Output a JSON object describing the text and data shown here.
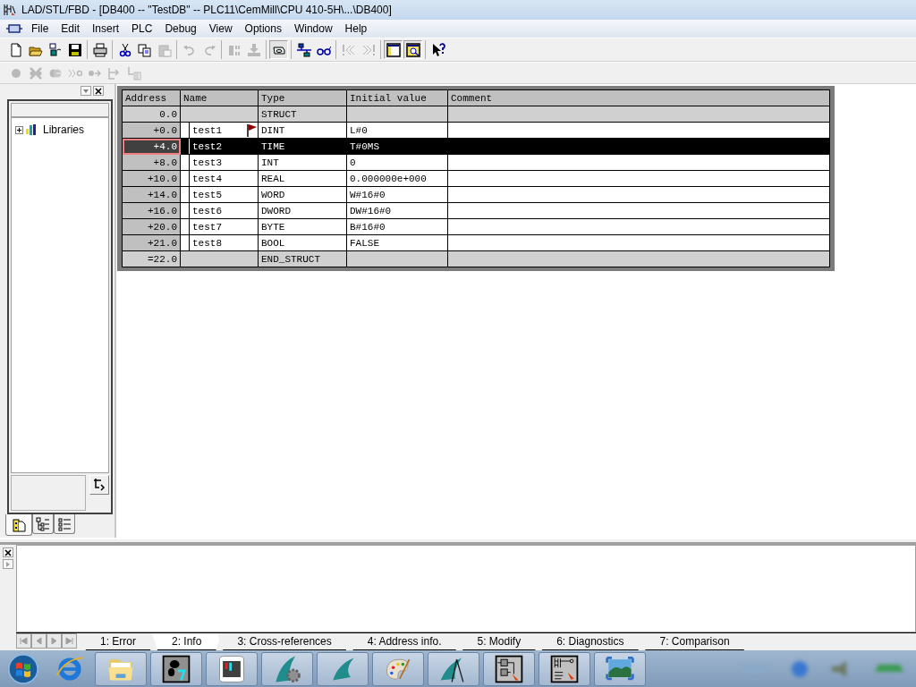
{
  "window": {
    "title": "LAD/STL/FBD  - [DB400 -- \"TestDB\" -- PLC11\\CemMill\\CPU 410-5H\\...\\DB400]"
  },
  "menu": [
    "File",
    "Edit",
    "Insert",
    "PLC",
    "Debug",
    "View",
    "Options",
    "Window",
    "Help"
  ],
  "toolbar": [
    {
      "buttons": [
        {
          "kind": "new",
          "disabled": false,
          "pressed": false
        },
        {
          "kind": "open",
          "disabled": false,
          "pressed": false
        },
        {
          "kind": "station",
          "disabled": false,
          "pressed": false
        },
        {
          "kind": "save",
          "disabled": false,
          "pressed": false
        }
      ]
    },
    {
      "buttons": [
        {
          "kind": "print",
          "disabled": false,
          "pressed": false
        }
      ]
    },
    {
      "buttons": [
        {
          "kind": "cut",
          "disabled": false,
          "pressed": false
        },
        {
          "kind": "copy",
          "disabled": false,
          "pressed": false
        },
        {
          "kind": "paste",
          "disabled": true,
          "pressed": false
        }
      ]
    },
    {
      "buttons": [
        {
          "kind": "undo",
          "disabled": true,
          "pressed": false
        },
        {
          "kind": "redo",
          "disabled": true,
          "pressed": false
        }
      ]
    },
    {
      "buttons": [
        {
          "kind": "block",
          "disabled": true,
          "pressed": false
        },
        {
          "kind": "download",
          "disabled": true,
          "pressed": false
        }
      ]
    },
    {
      "buttons": [
        {
          "kind": "overview",
          "disabled": false,
          "pressed": true
        }
      ]
    },
    {
      "buttons": [
        {
          "kind": "network",
          "disabled": false,
          "pressed": false
        },
        {
          "kind": "glasses",
          "disabled": false,
          "pressed": false
        }
      ]
    },
    {
      "buttons": [
        {
          "kind": "prev-error",
          "disabled": true,
          "pressed": false
        },
        {
          "kind": "next-error",
          "disabled": true,
          "pressed": false
        }
      ]
    },
    {
      "buttons": [
        {
          "kind": "panel",
          "disabled": false,
          "pressed": true
        },
        {
          "kind": "zoom",
          "disabled": false,
          "pressed": true
        }
      ]
    },
    {
      "buttons": [
        {
          "kind": "help",
          "disabled": false,
          "pressed": false
        }
      ]
    }
  ],
  "debug_toolbar": [
    {
      "buttons": [
        {
          "kind": "dot",
          "disabled": true,
          "pressed": false
        },
        {
          "kind": "dot-cross",
          "disabled": true,
          "pressed": false
        },
        {
          "kind": "dots-arrow",
          "disabled": true,
          "pressed": false
        },
        {
          "kind": "run-to",
          "disabled": true,
          "pressed": false
        },
        {
          "kind": "step",
          "disabled": true,
          "pressed": false
        },
        {
          "kind": "step-out",
          "disabled": true,
          "pressed": false
        },
        {
          "kind": "call",
          "disabled": true,
          "pressed": false
        }
      ]
    }
  ],
  "libraries_panel": {
    "tree": [
      {
        "label": "Libraries",
        "expanded": false
      }
    ],
    "tabs": [
      {
        "kind": "libraries",
        "selected": true
      },
      {
        "kind": "tree",
        "selected": false
      },
      {
        "kind": "list",
        "selected": false
      }
    ]
  },
  "table": {
    "columns": [
      "Address",
      "Name",
      "Type",
      "Initial value",
      "Comment"
    ],
    "rows": [
      {
        "kind": "struct",
        "address": "0.0",
        "type": "STRUCT",
        "selected": false
      },
      {
        "kind": "variable",
        "address": "+0.0",
        "name": "test1",
        "type": "DINT",
        "initial_value": "L#0",
        "flagged": true,
        "selected": false
      },
      {
        "kind": "variable",
        "address": "+4.0",
        "name": "test2",
        "type": "TIME",
        "initial_value": "T#0MS",
        "flagged": false,
        "selected": true
      },
      {
        "kind": "variable",
        "address": "+8.0",
        "name": "test3",
        "type": "INT",
        "initial_value": "0",
        "flagged": false,
        "selected": false
      },
      {
        "kind": "variable",
        "address": "+10.0",
        "name": "test4",
        "type": "REAL",
        "initial_value": "0.000000e+000",
        "flagged": false,
        "selected": false
      },
      {
        "kind": "variable",
        "address": "+14.0",
        "name": "test5",
        "type": "WORD",
        "initial_value": "W#16#0",
        "flagged": false,
        "selected": false
      },
      {
        "kind": "variable",
        "address": "+16.0",
        "name": "test6",
        "type": "DWORD",
        "initial_value": "DW#16#0",
        "flagged": false,
        "selected": false
      },
      {
        "kind": "variable",
        "address": "+20.0",
        "name": "test7",
        "type": "BYTE",
        "initial_value": "B#16#0",
        "flagged": false,
        "selected": false
      },
      {
        "kind": "variable",
        "address": "+21.0",
        "name": "test8",
        "type": "BOOL",
        "initial_value": "FALSE",
        "flagged": false,
        "selected": false
      },
      {
        "kind": "struct",
        "address": "=22.0",
        "type": "END_STRUCT",
        "selected": false
      }
    ]
  },
  "output_panel": {
    "tabs": [
      {
        "label": "1: Error",
        "selected": false
      },
      {
        "label": "2: Info",
        "selected": true
      },
      {
        "label": "3: Cross-references",
        "selected": false
      },
      {
        "label": "4: Address info.",
        "selected": false
      },
      {
        "label": "5: Modify",
        "selected": false
      },
      {
        "label": "6: Diagnostics",
        "selected": false
      },
      {
        "label": "7: Comparison",
        "selected": false
      }
    ]
  },
  "taskbar": {
    "items": [
      {
        "kind": "start"
      },
      {
        "kind": "browser"
      },
      {
        "kind": "folder"
      },
      {
        "kind": "simatic"
      },
      {
        "kind": "hardware"
      },
      {
        "kind": "gear-sail"
      },
      {
        "kind": "sail"
      },
      {
        "kind": "paint"
      },
      {
        "kind": "sail-compass"
      },
      {
        "kind": "block-diagram"
      },
      {
        "kind": "ladder"
      },
      {
        "kind": "photo"
      }
    ]
  }
}
